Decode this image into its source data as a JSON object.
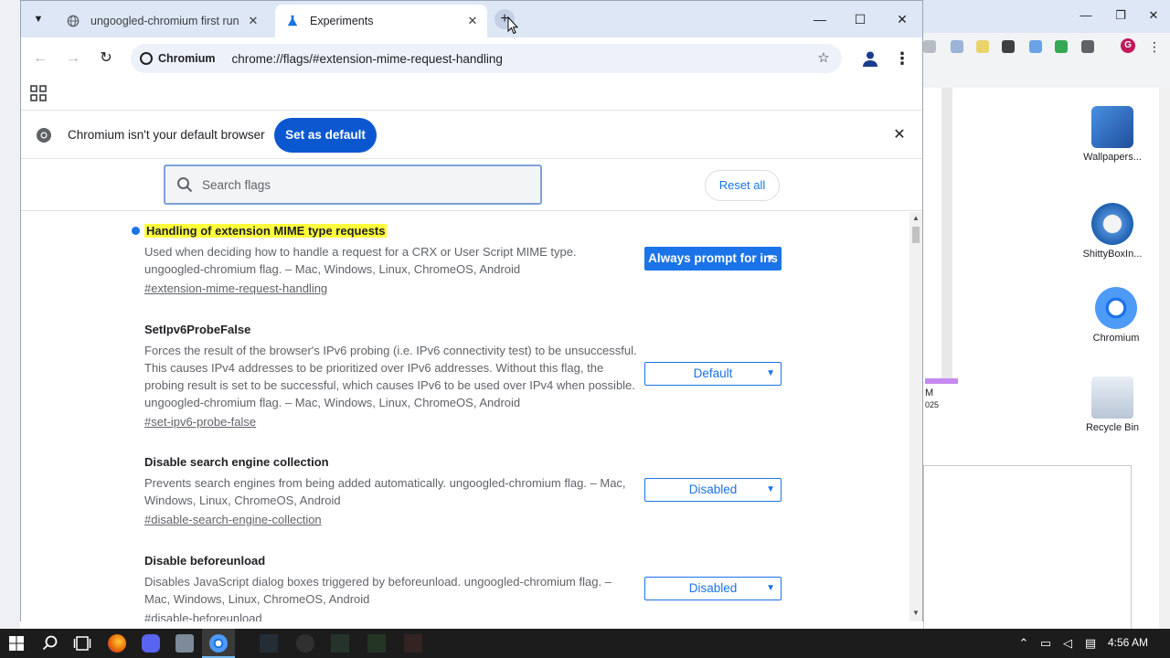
{
  "tabs": [
    {
      "title": "ungoogled-chromium first run",
      "active": false
    },
    {
      "title": "Experiments",
      "active": true
    }
  ],
  "toolbar": {
    "chip_label": "Chromium",
    "url": "chrome://flags/#extension-mime-request-handling"
  },
  "infobar": {
    "message": "Chromium isn't your default browser",
    "button": "Set as default"
  },
  "flags_header": {
    "search_placeholder": "Search flags",
    "reset_all": "Reset all"
  },
  "flags": [
    {
      "name": "Handling of extension MIME type requests",
      "description": "Used when deciding how to handle a request for a CRX or User Script MIME type. ungoogled-chromium flag. – Mac, Windows, Linux, ChromeOS, Android",
      "anchor": "#extension-mime-request-handling",
      "value": "Always prompt for ins",
      "highlighted": true
    },
    {
      "name": "SetIpv6ProbeFalse",
      "description": "Forces the result of the browser's IPv6 probing (i.e. IPv6 connectivity test) to be unsuccessful. This causes IPv4 addresses to be prioritized over IPv6 addresses. Without this flag, the probing result is set to be successful, which causes IPv6 to be used over IPv4 when possible. ungoogled-chromium flag. – Mac, Windows, Linux, ChromeOS, Android",
      "anchor": "#set-ipv6-probe-false",
      "value": "Default",
      "highlighted": false
    },
    {
      "name": "Disable search engine collection",
      "description": "Prevents search engines from being added automatically. ungoogled-chromium flag. – Mac, Windows, Linux, ChromeOS, Android",
      "anchor": "#disable-search-engine-collection",
      "value": "Disabled",
      "highlighted": false
    },
    {
      "name": "Disable beforeunload",
      "description": "Disables JavaScript dialog boxes triggered by beforeunload. ungoogled-chromium flag. – Mac, Windows, Linux, ChromeOS, Android",
      "anchor": "#disable-beforeunload",
      "value": "Disabled",
      "highlighted": false
    }
  ],
  "desktop_icons": [
    {
      "label": "Wallpapers..."
    },
    {
      "label": "ShittyBoxIn..."
    },
    {
      "label": "Chromium"
    },
    {
      "label": "Recycle Bin"
    }
  ],
  "bg_window_text": {
    "line1": "M",
    "line2": "025"
  },
  "profile_initial": "G",
  "taskbar": {
    "time": "4:56 AM"
  },
  "colors": {
    "accent": "#1a73e8",
    "set_default_bg": "#0b57d0",
    "highlight": "#ffff3c",
    "tabstrip": "#dee7f5"
  }
}
